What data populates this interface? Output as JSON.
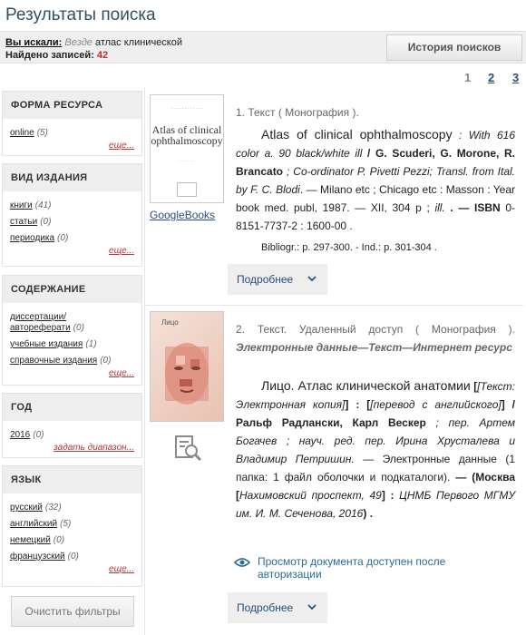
{
  "page": {
    "title": "Результаты поиска"
  },
  "summary": {
    "searched_label": "Вы искали:",
    "scope": "Везде",
    "query": "атлас клинической",
    "found_label": "Найдено записей:",
    "found_count": "42",
    "history_button": "История поисков"
  },
  "pager": {
    "p1": "1",
    "p2": "2",
    "p3": "3"
  },
  "facets": {
    "resource_form": {
      "title": "ФОРМА РЕСУРСА",
      "items": [
        {
          "label": "online",
          "count": "(5)"
        }
      ],
      "more": "еще..."
    },
    "publication_type": {
      "title": "ВИД ИЗДАНИЯ",
      "items": [
        {
          "label": "книги",
          "count": "(41)"
        },
        {
          "label": "статьи",
          "count": "(0)"
        },
        {
          "label": "периодика",
          "count": "(0)"
        }
      ],
      "more": "еще..."
    },
    "content": {
      "title": "СОДЕРЖАНИЕ",
      "items": [
        {
          "label": "диссертации/ автореферати",
          "count": "(0)"
        },
        {
          "label": "учебные издания",
          "count": "(1)"
        },
        {
          "label": "справочные издания",
          "count": "(0)"
        }
      ],
      "more": "еще..."
    },
    "year": {
      "title": "ГОД",
      "items": [
        {
          "label": "2016",
          "count": "(0)"
        }
      ],
      "more": "задать диапазон..."
    },
    "language": {
      "title": "ЯЗЫК",
      "items": [
        {
          "label": "русский",
          "count": "(32)"
        },
        {
          "label": "английский",
          "count": "(5)"
        },
        {
          "label": "немецкий",
          "count": "(0)"
        },
        {
          "label": "французский",
          "count": "(0)"
        }
      ],
      "more": "еще..."
    },
    "clear_button": "Очистить фильтры"
  },
  "results": [
    {
      "header": "1. Текст ( Монография ).",
      "cover_title": "Atlas of clinical ophthalmoscopy",
      "google_books": "GoogleBooks",
      "title": "Atlas of clinical ophthalmoscopy",
      "desc1": "With 616 color a. 90 black/white ill",
      "authors": "G. Scuderi, G. Morone, R. Brancato",
      "coauthors": "Co-ordinator P. Pivetti Pezzi; Transl. from Ital. by F. C. Blodi",
      "publication": "— Milano etc ; Chicago etc : Masson : Year book med. publ, 1987. — XII, 304 p ;",
      "ill": "ill.",
      "isbn_label": "ISBN",
      "isbn": "0-8151-7737-2 : 1600-00 .",
      "notes": "Bibliogr.: p. 297-300. - Ind.: p. 301-304 .",
      "more_button": "Подробнее"
    },
    {
      "header": "2. Текст. Удаленный доступ ( Монография ).",
      "subheader": "Электронные данные—Текст—Интернет ресурс",
      "title": "Лицо. Атлас клинической анатомии",
      "form_note": "[Текст: Электронная копия]",
      "translation": "[перевод с английского]",
      "authors": "Ральф Радлански, Карл Вескер",
      "editors": "пер. Артем Богачев ; науч. ред. пер. Ирина Хрусталева и Владимир Петришин.",
      "electronic": "— Электронные данные (1 папка: 1 файл оболочки и подкаталоги).",
      "place_start": "— (Москва [",
      "place": "Нахимовский проспект, 49",
      "place_end": "] : ",
      "publisher": "ЦНМБ Первого МГМУ им. И. М. Сеченова, 2016",
      "access_note": "Просмотр документа доступен после авторизации",
      "more_button": "Подробнее"
    }
  ],
  "icons": {
    "more_chevron": "chevron-down-icon",
    "access": "eye-icon",
    "preview": "document-search-icon"
  }
}
